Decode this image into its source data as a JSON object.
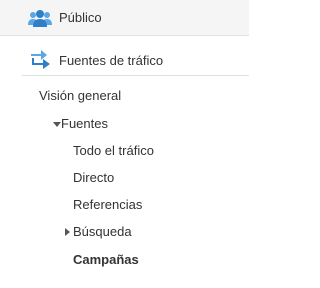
{
  "sections": {
    "publico": {
      "label": "Público",
      "icon": "audience-icon"
    },
    "fuentes_trafico": {
      "label": "Fuentes de tráfico",
      "icon": "traffic-sources-icon",
      "items": {
        "vision_general": "Visión general",
        "fuentes": "Fuentes",
        "todo_trafico": "Todo el tráfico",
        "directo": "Directo",
        "referencias": "Referencias",
        "busqueda": "Búsqueda",
        "campanas": "Campañas"
      }
    }
  },
  "colors": {
    "accent": "#2c6fa6",
    "icon_blue": "#3b8ad1",
    "header_bg": "#f5f5f5"
  }
}
